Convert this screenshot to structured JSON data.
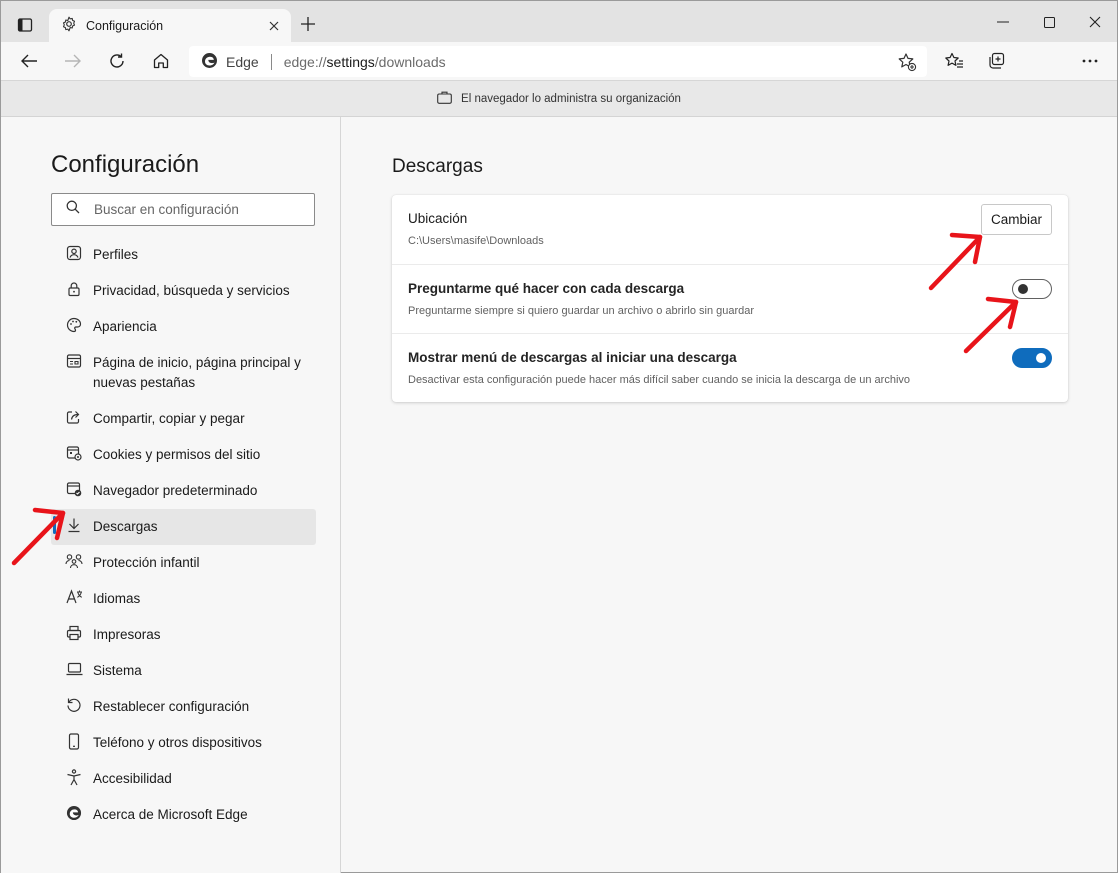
{
  "window": {
    "tab_title": "Configuración",
    "tab_icon": "gear-icon"
  },
  "toolbar": {
    "brand": "Edge",
    "url_protocol": "edge://",
    "url_host": "settings",
    "url_path": "/downloads"
  },
  "managed_bar": {
    "text": "El navegador lo administra su organización"
  },
  "sidebar": {
    "title": "Configuración",
    "search_placeholder": "Buscar en configuración",
    "items": [
      {
        "label": "Perfiles",
        "icon": "profile-icon"
      },
      {
        "label": "Privacidad, búsqueda y servicios",
        "icon": "lock-icon"
      },
      {
        "label": "Apariencia",
        "icon": "palette-icon"
      },
      {
        "label": "Página de inicio, página principal y nuevas pestañas",
        "icon": "home-page-icon"
      },
      {
        "label": "Compartir, copiar y pegar",
        "icon": "share-icon"
      },
      {
        "label": "Cookies y permisos del sitio",
        "icon": "cookies-icon"
      },
      {
        "label": "Navegador predeterminado",
        "icon": "default-browser-icon"
      },
      {
        "label": "Descargas",
        "icon": "download-icon",
        "active": true
      },
      {
        "label": "Protección infantil",
        "icon": "family-icon"
      },
      {
        "label": "Idiomas",
        "icon": "language-icon"
      },
      {
        "label": "Impresoras",
        "icon": "printer-icon"
      },
      {
        "label": "Sistema",
        "icon": "laptop-icon"
      },
      {
        "label": "Restablecer configuración",
        "icon": "reset-icon"
      },
      {
        "label": "Teléfono y otros dispositivos",
        "icon": "phone-icon"
      },
      {
        "label": "Accesibilidad",
        "icon": "accessibility-icon"
      },
      {
        "label": "Acerca de Microsoft Edge",
        "icon": "edge-logo-icon"
      }
    ]
  },
  "main": {
    "title": "Descargas",
    "location": {
      "title": "Ubicación",
      "path": "C:\\Users\\masife\\Downloads",
      "button": "Cambiar"
    },
    "ask": {
      "title": "Preguntarme qué hacer con cada descarga",
      "description": "Preguntarme siempre si quiero guardar un archivo o abrirlo sin guardar",
      "enabled": false
    },
    "menu": {
      "title": "Mostrar menú de descargas al iniciar una descarga",
      "description": "Desactivar esta configuración puede hacer más difícil saber cuando se inicia la descarga de un archivo",
      "enabled": true
    }
  },
  "colors": {
    "accent": "#0f6cbd",
    "annotation_arrow": "#e8141a"
  }
}
